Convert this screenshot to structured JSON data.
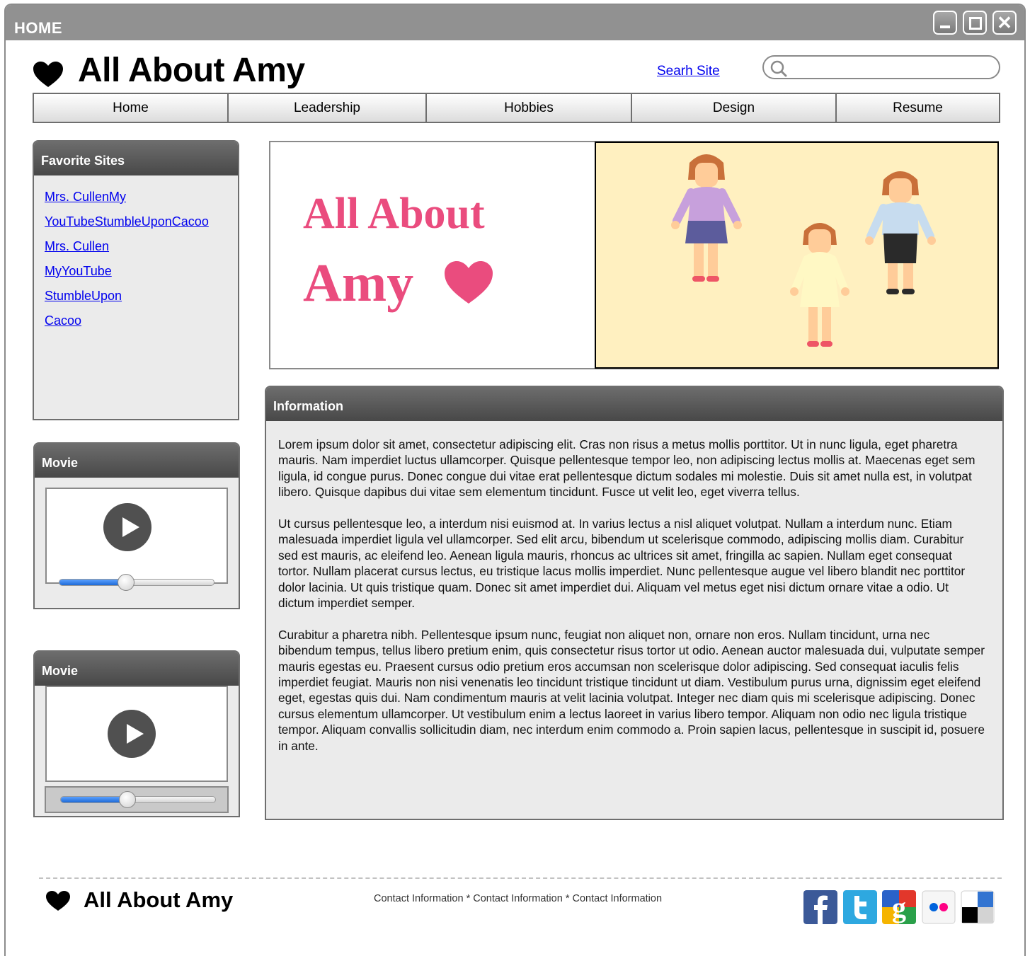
{
  "window": {
    "title": "HOME"
  },
  "header": {
    "site_title": "All About Amy",
    "search_link": "Searh Site",
    "search_value": ""
  },
  "nav": {
    "tabs": [
      {
        "label": "Home"
      },
      {
        "label": "Leadership"
      },
      {
        "label": "Hobbies"
      },
      {
        "label": "Design"
      },
      {
        "label": "Resume"
      }
    ]
  },
  "favorites": {
    "title": "Favorite Sites",
    "links": [
      "Mrs. CullenMy ",
      "YouTubeStumbleUponCacoo",
      "Mrs. Cullen",
      "MyYouTube",
      "StumbleUpon",
      "Cacoo"
    ]
  },
  "movies": [
    {
      "title": "Movie",
      "progress": 0.43
    },
    {
      "title": "Movie",
      "progress": 0.43
    }
  ],
  "banner": {
    "line1": "All About",
    "line2": "Amy",
    "background": "#fff0c0",
    "accent": "#ea4c7e"
  },
  "information": {
    "title": "Information",
    "paragraphs": [
      "Lorem ipsum dolor sit amet, consectetur adipiscing elit. Cras non risus a metus mollis porttitor. Ut in nunc ligula, eget pharetra mauris. Nam imperdiet luctus ullamcorper. Quisque pellentesque tempor leo, non adipiscing lectus mollis at. Maecenas eget sem ligula, id congue purus. Donec congue dui vitae erat pellentesque dictum sodales mi molestie. Duis sit amet nulla est, in volutpat libero. Quisque dapibus dui vitae sem elementum tincidunt. Fusce ut velit leo, eget viverra tellus.",
      "Ut cursus pellentesque leo, a interdum nisi euismod at. In varius lectus a nisl aliquet volutpat. Nullam a interdum nunc. Etiam malesuada imperdiet ligula vel ullamcorper. Sed elit arcu, bibendum ut scelerisque commodo, adipiscing mollis diam. Curabitur sed est mauris, ac eleifend leo. Aenean ligula mauris, rhoncus ac ultrices sit amet, fringilla ac sapien. Nullam eget consequat tortor. Nullam placerat cursus lectus, eu tristique lacus mollis imperdiet. Nunc pellentesque augue vel libero blandit nec porttitor dolor lacinia. Ut quis tristique quam. Donec sit amet imperdiet dui. Aliquam vel metus eget nisi dictum ornare vitae a odio. Ut dictum imperdiet semper.",
      "Curabitur a pharetra nibh. Pellentesque ipsum nunc, feugiat non aliquet non, ornare non eros. Nullam tincidunt, urna nec bibendum tempus, tellus libero pretium enim, quis consectetur risus tortor ut odio. Aenean auctor malesuada dui, vulputate semper mauris egestas eu. Praesent cursus odio pretium eros accumsan non scelerisque dolor adipiscing. Sed consequat iaculis felis imperdiet feugiat. Mauris non nisi venenatis leo tincidunt tristique tincidunt ut diam. Vestibulum purus urna, dignissim eget eleifend eget, egestas quis dui. Nam condimentum mauris at velit lacinia volutpat. Integer nec diam quis mi scelerisque adipiscing. Donec cursus elementum ullamcorper. Ut vestibulum enim a lectus laoreet in varius libero tempor. Aliquam non odio nec ligula tristique tempor. Aliquam convallis sollicitudin diam, nec interdum enim commodo a. Proin sapien lacus, pellentesque in suscipit id, posuere in ante."
    ]
  },
  "footer": {
    "title": "All About Amy",
    "contact_1": "Contact Information",
    "contact_2": "Contact Information",
    "contact_3": "Contact Information",
    "separator": " * ",
    "social": [
      {
        "icon": "facebook-icon",
        "color": "#3b5998",
        "glyph": "f"
      },
      {
        "icon": "twitter-icon",
        "color": "#2ea8e0",
        "glyph": "t"
      },
      {
        "icon": "google-icon",
        "color": "#2a62c9",
        "glyph": "g"
      },
      {
        "icon": "flickr-icon",
        "color": "#f2f2f2",
        "glyph": ""
      },
      {
        "icon": "delicious-icon",
        "color": "#ffffff",
        "glyph": ""
      }
    ]
  }
}
